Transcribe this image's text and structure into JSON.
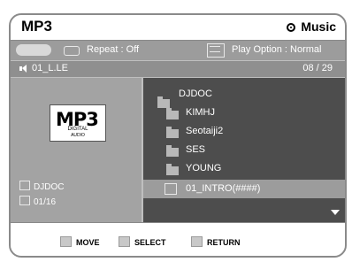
{
  "header": {
    "title": "MP3",
    "mode_label": "Music",
    "mode_icon": "disc-icon"
  },
  "options": {
    "pill": "",
    "repeat": "Repeat : Off",
    "play_option": "Play Option : Normal"
  },
  "info": {
    "track": "01_L.LE",
    "count": "08 / 29"
  },
  "left_panel": {
    "logo_mark": "MP3",
    "logo_sub1": "DIGITAL",
    "logo_sub2": "AUDIO",
    "folder_label": "DJDOC",
    "track_label": "01/16"
  },
  "list": {
    "items": [
      {
        "label": "DJDOC",
        "type": "folder",
        "selected": false
      },
      {
        "label": "KIMHJ",
        "type": "folder",
        "selected": false
      },
      {
        "label": "Seotaiji2",
        "type": "folder",
        "selected": false
      },
      {
        "label": "SES",
        "type": "folder",
        "selected": false
      },
      {
        "label": "YOUNG",
        "type": "folder",
        "selected": false
      },
      {
        "label": "01_INTRO(####)",
        "type": "file",
        "selected": true
      }
    ]
  },
  "footer": {
    "move": "MOVE",
    "select": "SELECT",
    "return": "RETURN"
  },
  "colors": {
    "panel_dark": "#4d4d4d",
    "panel_mid": "#a3a3a3",
    "selection": "#9c9c9c"
  }
}
